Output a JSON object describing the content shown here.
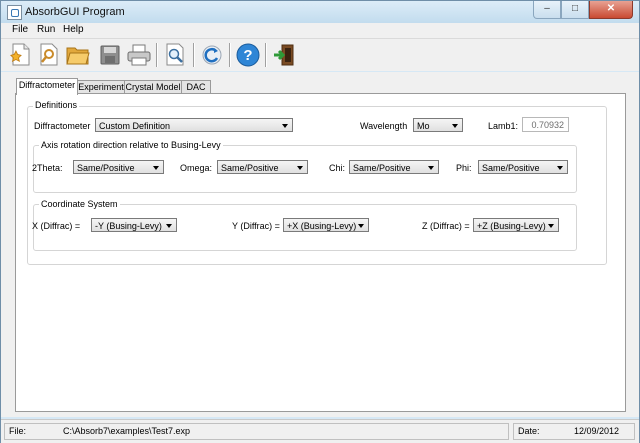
{
  "window": {
    "title": "AbsorbGUI Program",
    "minimize": "–",
    "maximize": "□",
    "close": "✕"
  },
  "menu": [
    "File",
    "Run",
    "Help"
  ],
  "toolbar": {
    "buttons": [
      "new-file-icon",
      "open-find-icon",
      "open-folder-icon",
      "save-icon",
      "print-icon",
      "preview-icon",
      "refresh-icon",
      "help-icon",
      "exit-icon"
    ],
    "help_glyph": "?"
  },
  "tabs": [
    "Diffractometer",
    "Experiment",
    "Crystal Model",
    "DAC"
  ],
  "definitions": {
    "legend": "Definitions",
    "diffractometer_label": "Diffractometer",
    "diffractometer_value": "Custom Definition",
    "wavelength_label": "Wavelength",
    "wavelength_value": "Mo",
    "lamb1_label": "Lamb1:",
    "lamb1_value": "0.70932"
  },
  "axis": {
    "legend": "Axis rotation direction relative to Busing-Levy",
    "twotheta_label": "2Theta:",
    "twotheta_value": "Same/Positive",
    "omega_label": "Omega:",
    "omega_value": "Same/Positive",
    "chi_label": "Chi:",
    "chi_value": "Same/Positive",
    "phi_label": "Phi:",
    "phi_value": "Same/Positive"
  },
  "coords": {
    "legend": "Coordinate System",
    "x_label": "X (Diffrac) =",
    "x_value": "-Y (Busing-Levy)",
    "y_label": "Y (Diffrac) =",
    "y_value": "+X (Busing-Levy)",
    "z_label": "Z (Diffrac) =",
    "z_value": "+Z (Busing-Levy)"
  },
  "status": {
    "file_label": "File:",
    "file_value": "C:\\Absorb7\\examples\\Test7.exp",
    "date_label": "Date:",
    "date_value": "12/09/2012"
  }
}
